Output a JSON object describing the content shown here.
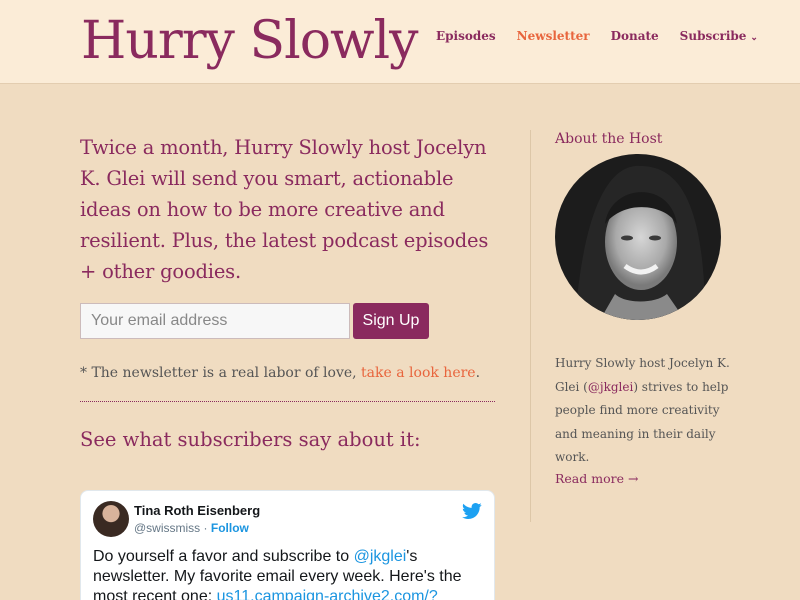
{
  "header": {
    "logo": "Hurry Slowly",
    "nav": [
      {
        "label": "Episodes",
        "active": false
      },
      {
        "label": "Newsletter",
        "active": true
      },
      {
        "label": "Donate",
        "active": false
      },
      {
        "label": "Subscribe",
        "active": false
      }
    ]
  },
  "main": {
    "intro": "Twice a month, Hurry Slowly host Jocelyn K. Glei will send you smart, actionable ideas on how to be more creative and resilient. Plus, the latest podcast episodes + other goodies.",
    "email_placeholder": "Your email address",
    "signup_label": "Sign Up",
    "note_prefix": "* The newsletter is a real labor of love, ",
    "note_link": "take a look here",
    "note_suffix": ".",
    "testimonials_title": "See what subscribers say about it:"
  },
  "tweet": {
    "name": "Tina Roth Eisenberg",
    "handle": "@swissmiss",
    "separator": " · ",
    "follow": "Follow",
    "text_1": "Do yourself a favor and subscribe to ",
    "mention": "@jkglei",
    "text_2": "'s newsletter. My favorite email every week. Here's the most recent one: ",
    "link": "us11.campaign-archive2.com/?"
  },
  "sidebar": {
    "title": "About the Host",
    "bio_1": "Hurry Slowly host Jocelyn K. Glei (",
    "bio_handle": "@jkglei",
    "bio_2": ") strives to help people find more creativity and meaning in their daily work.",
    "read_more": "Read more →"
  },
  "colors": {
    "brand": "#8a2a5e",
    "accent": "#e8653d",
    "background": "#f0dcc1",
    "header_background": "#fbecd7",
    "twitter_blue": "#1b95e0"
  },
  "icons": {
    "subscribe_dropdown": "chevron-down-icon",
    "tweet_brand": "twitter-bird-icon"
  }
}
